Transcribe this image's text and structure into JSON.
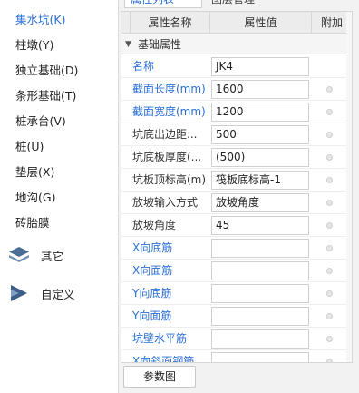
{
  "sidebar": {
    "items": [
      {
        "label": "集水坑(K)",
        "active": true
      },
      {
        "label": "柱墩(Y)"
      },
      {
        "label": "独立基础(D)"
      },
      {
        "label": "条形基础(T)"
      },
      {
        "label": "桩承台(V)"
      },
      {
        "label": "桩(U)"
      },
      {
        "label": "垫层(X)"
      },
      {
        "label": "地沟(G)"
      },
      {
        "label": "砖胎膜"
      }
    ],
    "groups": [
      {
        "label": "其它",
        "icon": "layers-icon"
      },
      {
        "label": "自定义",
        "icon": "custom-shape-icon"
      }
    ]
  },
  "panel": {
    "tabs": [
      "属性列表",
      "图层管理"
    ],
    "columns": [
      "属性名称",
      "属性值",
      "附加"
    ],
    "group_label": "基础属性",
    "rows": [
      {
        "name": "名称",
        "value": "JK4",
        "blue": true,
        "attach": false
      },
      {
        "name": "截面长度(mm)",
        "value": "1600",
        "blue": true,
        "attach": true
      },
      {
        "name": "截面宽度(mm)",
        "value": "1200",
        "blue": true,
        "attach": true
      },
      {
        "name": "坑底出边距...",
        "value": "500",
        "blue": false,
        "attach": true
      },
      {
        "name": "坑底板厚度(...",
        "value": "(500)",
        "blue": false,
        "attach": true
      },
      {
        "name": "坑板顶标高(m)",
        "value": "筏板底标高-1",
        "blue": false,
        "attach": true
      },
      {
        "name": "放坡输入方式",
        "value": "放坡角度",
        "blue": false,
        "attach": true
      },
      {
        "name": "放坡角度",
        "value": "45",
        "blue": false,
        "attach": true
      },
      {
        "name": "X向底筋",
        "value": "",
        "blue": true,
        "attach": true
      },
      {
        "name": "X向面筋",
        "value": "",
        "blue": true,
        "attach": true
      },
      {
        "name": "Y向底筋",
        "value": "",
        "blue": true,
        "attach": true
      },
      {
        "name": "Y向面筋",
        "value": "",
        "blue": true,
        "attach": true
      },
      {
        "name": "坑壁水平筋",
        "value": "",
        "blue": true,
        "attach": true
      },
      {
        "name": "X向斜面钢筋",
        "value": "",
        "blue": true,
        "attach": true
      }
    ],
    "button_label": "参数图"
  },
  "colors": {
    "accent": "#2a6fd6",
    "panel_bg": "#f2f2f2",
    "header_bg": "#ececec"
  }
}
